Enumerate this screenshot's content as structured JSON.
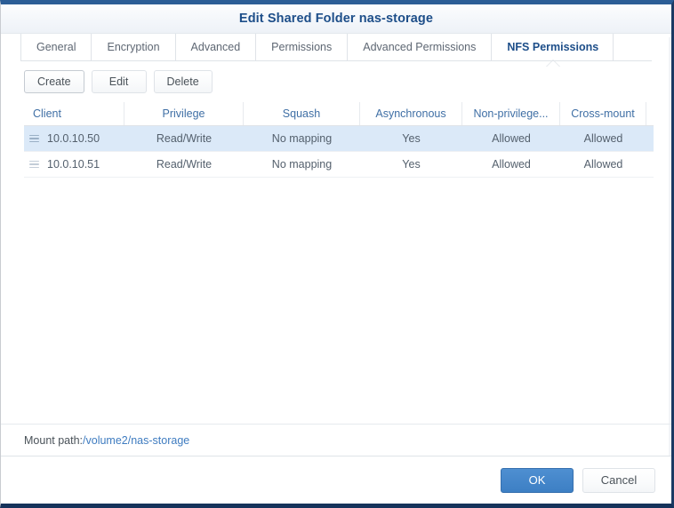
{
  "window": {
    "title": "Edit Shared Folder nas-storage",
    "accent_color": "#1d4e89",
    "titlebar_top_color": "#2b5d96"
  },
  "tabs": [
    {
      "label": "General",
      "active": false
    },
    {
      "label": "Encryption",
      "active": false
    },
    {
      "label": "Advanced",
      "active": false
    },
    {
      "label": "Permissions",
      "active": false
    },
    {
      "label": "Advanced Permissions",
      "active": false
    },
    {
      "label": "NFS Permissions",
      "active": true
    }
  ],
  "toolbar": {
    "create_label": "Create",
    "edit_label": "Edit",
    "delete_label": "Delete"
  },
  "table": {
    "columns": [
      "Client",
      "Privilege",
      "Squash",
      "Asynchronous",
      "Non-privilege...",
      "Cross-mount",
      ""
    ],
    "rows": [
      {
        "selected": true,
        "client": "10.0.10.50",
        "privilege": "Read/Write",
        "squash": "No mapping",
        "asynchronous": "Yes",
        "non_privilege": "Allowed",
        "cross_mount": "Allowed",
        "extra": ""
      },
      {
        "selected": false,
        "client": "10.0.10.51",
        "privilege": "Read/Write",
        "squash": "No mapping",
        "asynchronous": "Yes",
        "non_privilege": "Allowed",
        "cross_mount": "Allowed",
        "extra": ""
      }
    ]
  },
  "mount_path": {
    "label": "Mount path:",
    "value": "/volume2/nas-storage",
    "value_color": "#3f7cc0"
  },
  "footer": {
    "ok_label": "OK",
    "cancel_label": "Cancel",
    "ok_color": "#3d7fc4"
  }
}
